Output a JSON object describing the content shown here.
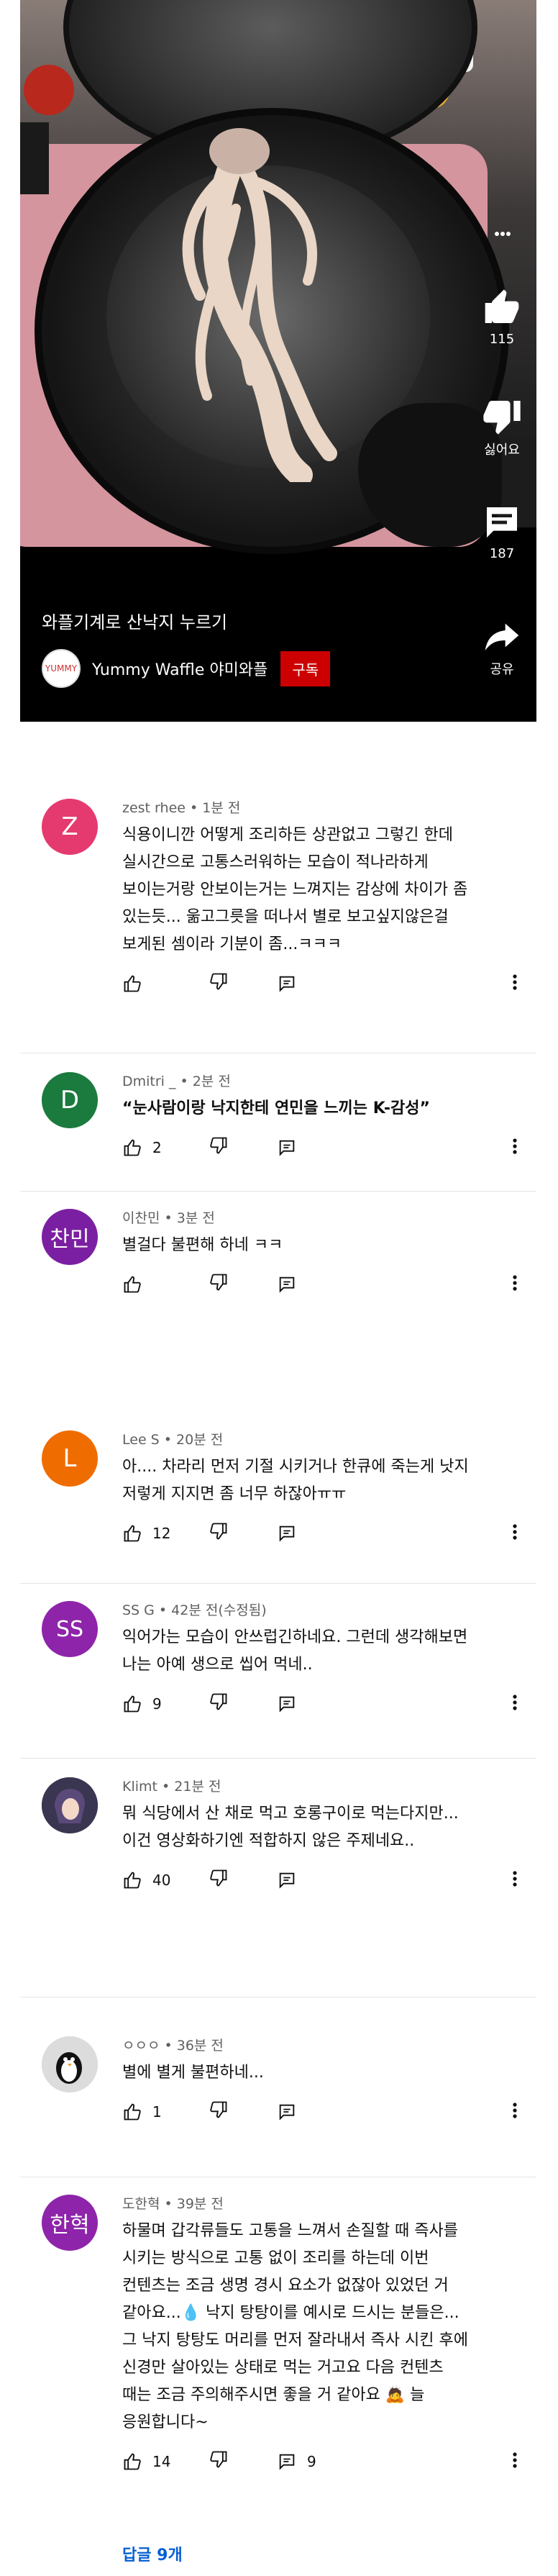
{
  "video": {
    "title": "와플기계로 산낙지 누르기",
    "channel_name": "Yummy Waffle 야미와플",
    "channel_avatar_text": "YUMMY",
    "subscribe_label": "구독",
    "likes": "115",
    "dislike_label": "싫어요",
    "comment_count": "187",
    "share_label": "공유"
  },
  "comments": [
    {
      "avatar_text": "Z",
      "avatar_color": "#e53a6f",
      "meta": "zest rhee • 1분 전",
      "lines": [
        "식용이니깐 어떻게 조리하든 상관없고 그렇긴 한데",
        "실시간으로 고통스러워하는 모습이 적나라하게",
        "보이는거랑 안보이는거는 느껴지는 감상에 차이가 좀",
        "있는듯... 욺고그릇을 떠나서 별로 보고싶지않은걸",
        "보게된 셈이라 기분이 좀...ㅋㅋㅋ"
      ],
      "likes": ""
    },
    {
      "avatar_text": "D",
      "avatar_color": "#1b7a3d",
      "meta": "Dmitri _ • 2분 전",
      "lines": [
        "“눈사람이랑 낙지한테 연민을 느끼는 K-감성”"
      ],
      "likes": "2"
    },
    {
      "avatar_text": "찬민",
      "avatar_color": "#7b1fa2",
      "meta": "이찬민 • 3분 전",
      "lines": [
        "별걸다 불편해 하네 ㅋㅋ"
      ],
      "likes": ""
    },
    {
      "avatar_text": "L",
      "avatar_color": "#ef6c00",
      "meta": "Lee S • 20분 전",
      "lines": [
        "아.... 차라리 먼저 기절 시키거나 한큐에 죽는게 낫지",
        "저렇게 지지면 좀 너무 하잖아ㅠㅠ"
      ],
      "likes": "12"
    },
    {
      "avatar_text": "SS",
      "avatar_color": "#8e24aa",
      "meta": "SS G • 42분 전(수정됨)",
      "lines": [
        "익어가는 모습이 안쓰럽긴하네요. 그런데 생각해보면",
        "나는 아예 생으로 씹어 먹네.."
      ],
      "likes": "9"
    },
    {
      "avatar_text": "",
      "avatar_color": "#3a3550",
      "meta": "Klimt • 21분 전",
      "lines": [
        "뭐 식당에서 산 채로 먹고 호롱구이로 먹는다지만...",
        "이건 영상화하기엔 적합하지 않은 주제네요.."
      ],
      "likes": "40"
    },
    {
      "avatar_text": "",
      "avatar_color": "#dadada",
      "meta": "ㅇㅇㅇ • 36분 전",
      "lines": [
        "별에 별게 불편하네..."
      ],
      "likes": "1"
    },
    {
      "avatar_text": "한혁",
      "avatar_color": "#8e24aa",
      "meta": "도한혁 • 39분 전",
      "lines": [
        "하물며 갑각류들도 고통을 느껴서 손질할 때 즉사를",
        "시키는 방식으로 고통 없이 조리를 하는데 이번",
        "컨텐츠는 조금 생명 경시 요소가 없잖아 있었던 거",
        "같아요...💧 낙지 탕탕이를 예시로 드시는 분들은...",
        "그 낙지 탕탕도 머리를 먼저 잘라내서 즉사 시킨 후에",
        "신경만 살아있는 상태로 먹는 거고요 다음 컨텐츠",
        "때는 조금 주의해주시면 좋을 거 같아요 🙇 늘",
        "응원합니다~"
      ],
      "likes": "14",
      "replies": "9"
    }
  ],
  "replies_label": "답글 9개"
}
